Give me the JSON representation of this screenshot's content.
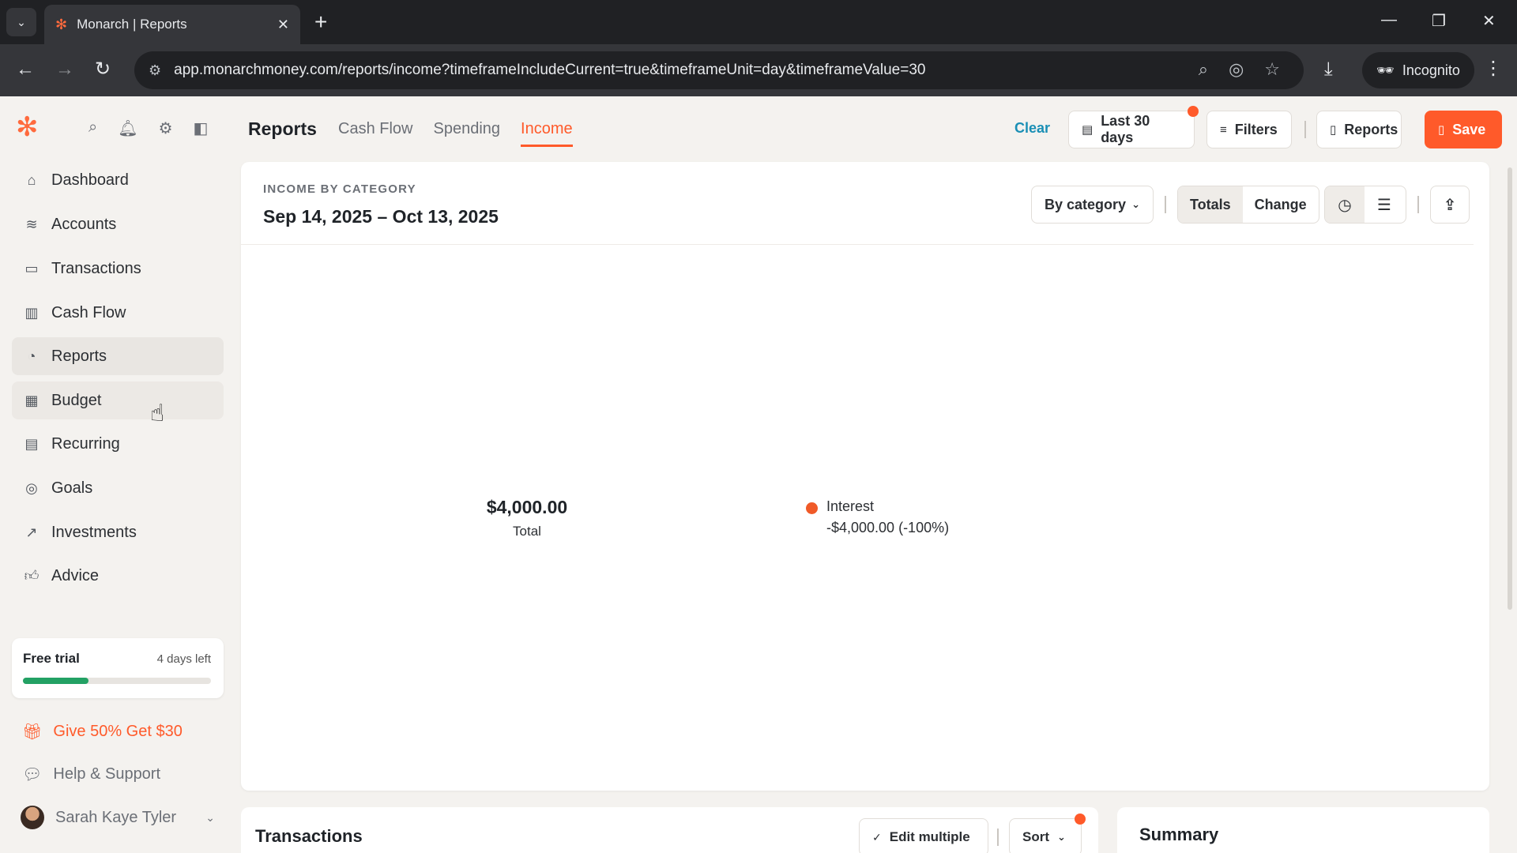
{
  "browser": {
    "tab_title": "Monarch | Reports",
    "url": "app.monarchmoney.com/reports/income?timeframeIncludeCurrent=true&timeframeUnit=day&timeframeValue=30",
    "incognito_label": "Incognito"
  },
  "sidebar": {
    "items": [
      {
        "label": "Dashboard",
        "icon": "home-icon"
      },
      {
        "label": "Accounts",
        "icon": "layers-icon"
      },
      {
        "label": "Transactions",
        "icon": "card-icon"
      },
      {
        "label": "Cash Flow",
        "icon": "bar-chart-icon"
      },
      {
        "label": "Reports",
        "icon": "pie-chart-icon"
      },
      {
        "label": "Budget",
        "icon": "map-icon"
      },
      {
        "label": "Recurring",
        "icon": "calendar-icon"
      },
      {
        "label": "Goals",
        "icon": "target-icon"
      },
      {
        "label": "Investments",
        "icon": "trend-icon"
      },
      {
        "label": "Advice",
        "icon": "thumbs-up-icon"
      }
    ],
    "trial": {
      "label": "Free trial",
      "days_left": "4 days left",
      "progress": 0.35
    },
    "promo": "Give 50% Get $30",
    "help": "Help & Support",
    "user_name": "Sarah Kaye Tyler"
  },
  "header": {
    "title": "Reports",
    "tabs": [
      "Cash Flow",
      "Spending",
      "Income"
    ],
    "active_tab": "Income",
    "clear_label": "Clear",
    "date_range_label": "Last 30 days",
    "filters_label": "Filters",
    "reports_label": "Reports",
    "save_label": "Save"
  },
  "report": {
    "section_label": "INCOME BY CATEGORY",
    "date_range": "Sep 14, 2025 – Oct 13, 2025",
    "group_by": "By category",
    "view_totals": "Totals",
    "view_change": "Change",
    "total_value": "$4,000.00",
    "total_label": "Total",
    "legend": [
      {
        "name": "Interest",
        "value": "-$4,000.00 (-100%)",
        "color": "#f05a28"
      }
    ]
  },
  "transactions": {
    "title": "Transactions",
    "edit_multiple": "Edit multiple",
    "sort": "Sort"
  },
  "summary": {
    "title": "Summary"
  },
  "colors": {
    "accent": "#ff5a2a",
    "link": "#1a8fb5",
    "progress": "#23a164"
  }
}
